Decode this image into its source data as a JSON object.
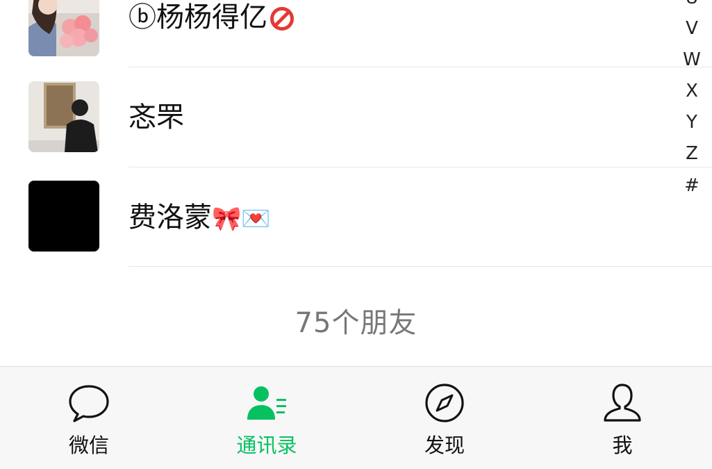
{
  "contacts": [
    {
      "name": "ⓑ杨杨得亿",
      "avatar": "avatar-girl-with-roses",
      "badge": "no-entry-emoji"
    },
    {
      "name": "忞罘",
      "avatar": "avatar-man-in-gallery"
    },
    {
      "name": "费洛蒙",
      "avatar": "avatar-black",
      "badges": [
        "🎀",
        "💌"
      ]
    }
  ],
  "index_letters": [
    "U",
    "V",
    "W",
    "X",
    "Y",
    "Z",
    "#"
  ],
  "friend_count": "75个朋友",
  "tabs": [
    {
      "label": "微信",
      "icon": "chat-bubble-icon",
      "active": false
    },
    {
      "label": "通讯录",
      "icon": "contacts-icon",
      "active": true
    },
    {
      "label": "发现",
      "icon": "compass-icon",
      "active": false
    },
    {
      "label": "我",
      "icon": "person-icon",
      "active": false
    }
  ],
  "colors": {
    "accent": "#07c160",
    "text": "#111111",
    "muted": "#777777",
    "tabbar_bg": "#f7f7f7"
  }
}
